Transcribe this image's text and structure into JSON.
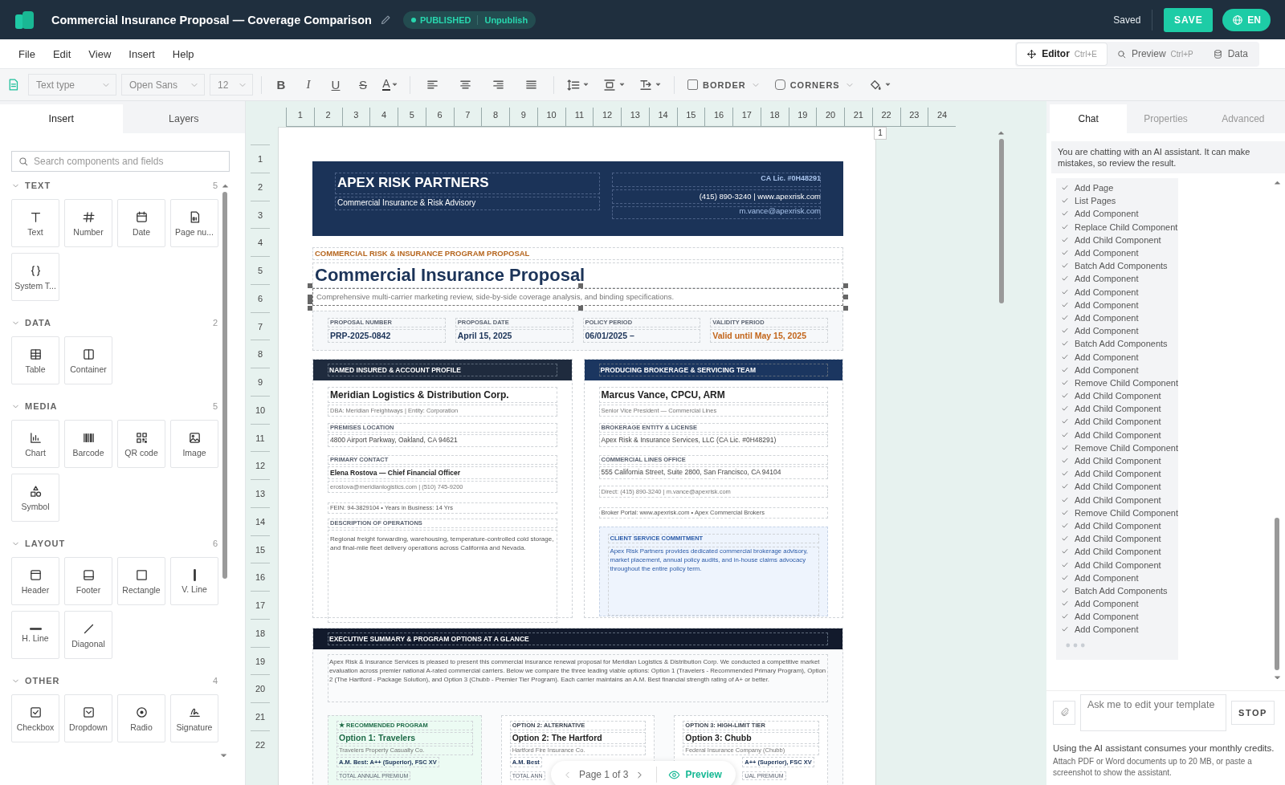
{
  "app_bar": {
    "title": "Commercial Insurance Proposal — Coverage Comparison",
    "status": "PUBLISHED",
    "unpublish": "Unpublish",
    "saved": "Saved",
    "save": "SAVE",
    "language": "EN"
  },
  "menu": [
    "File",
    "Edit",
    "View",
    "Insert",
    "Help"
  ],
  "modes": [
    {
      "label": "Editor",
      "shortcut": "Ctrl+E",
      "selected": true
    },
    {
      "label": "Preview",
      "shortcut": "Ctrl+P",
      "selected": false
    },
    {
      "label": "Data",
      "selected": false
    }
  ],
  "toolbar": {
    "text_type": "Text type",
    "font": "Open Sans",
    "size": "12",
    "styles": [
      "B",
      "I",
      "U",
      "S"
    ],
    "font_color": "A",
    "border": {
      "label": "BORDER",
      "checked": false
    },
    "corners": {
      "label": "CORNERS",
      "checked": false
    }
  },
  "left_panel": {
    "tabs": [
      {
        "label": "Insert",
        "selected": true
      },
      {
        "label": "Layers",
        "selected": false
      }
    ],
    "search": {
      "placeholder": "Search components and fields"
    },
    "sections": [
      {
        "title": "TEXT",
        "count": "5",
        "expanded": true,
        "items": [
          "Text",
          "Number",
          "Date",
          "Page nu...",
          "System T..."
        ]
      },
      {
        "title": "DATA",
        "count": "2",
        "expanded": true,
        "items": [
          "Table",
          "Container"
        ]
      },
      {
        "title": "MEDIA",
        "count": "5",
        "expanded": true,
        "items": [
          "Chart",
          "Barcode",
          "QR code",
          "Image",
          "Symbol"
        ]
      },
      {
        "title": "LAYOUT",
        "count": "6",
        "expanded": true,
        "items": [
          "Header",
          "Footer",
          "Rectangle",
          "V. Line",
          "H. Line",
          "Diagonal"
        ]
      },
      {
        "title": "OTHER",
        "count": "4",
        "expanded": true,
        "items": [
          "Checkbox",
          "Dropdown",
          "Radio",
          "Signature"
        ]
      }
    ]
  },
  "ruler": {
    "columns": [
      "1",
      "2",
      "3",
      "4",
      "5",
      "6",
      "7",
      "8",
      "9",
      "10",
      "11",
      "12",
      "13",
      "14",
      "15",
      "16",
      "17",
      "18",
      "19",
      "20",
      "21",
      "22",
      "23",
      "24"
    ],
    "rows": [
      "1",
      "2",
      "3",
      "4",
      "5",
      "6",
      "7",
      "8",
      "9",
      "10",
      "11",
      "12",
      "13",
      "14",
      "15",
      "16",
      "17",
      "18",
      "19",
      "20",
      "21",
      "22"
    ],
    "page_number": "1"
  },
  "document": {
    "header": {
      "company": "APEX RISK PARTNERS",
      "tagline": "Commercial Insurance & Risk Advisory",
      "license": "CA Lic. #0H48291",
      "contact": "(415) 890-3240  |  www.apexrisk.com",
      "email": "m.vance@apexrisk.com"
    },
    "eyebrow": "COMMERCIAL RISK & INSURANCE PROGRAM PROPOSAL",
    "title": "Commercial Insurance Proposal",
    "subtitle": {
      "text": "Comprehensive multi-carrier marketing review, side-by-side coverage analysis, and binding specifications.",
      "selected": true
    },
    "meta": [
      {
        "label": "PROPOSAL NUMBER",
        "value": "PRP-2025-0842",
        "kind": "normal"
      },
      {
        "label": "PROPOSAL DATE",
        "value": "April 15, 2025",
        "kind": "normal"
      },
      {
        "label": "POLICY PERIOD",
        "value": "06/01/2025 –",
        "kind": "normal"
      },
      {
        "label": "VALIDITY PERIOD",
        "value": "Valid until May 15, 2025",
        "kind": "alert"
      }
    ],
    "cards": [
      {
        "heading": "NAMED INSURED & ACCOUNT PROFILE",
        "color": "#1f2b3e",
        "blocks": [
          {
            "kind": "name",
            "text": "Meridian Logistics & Distribution Corp."
          },
          {
            "kind": "sub",
            "text": "DBA: Meridian Freightways  |  Entity: Corporation"
          },
          {
            "kind": "label",
            "text": "PREMISES LOCATION"
          },
          {
            "kind": "value",
            "text": "4800 Airport Parkway, Oakland, CA 94621"
          },
          {
            "kind": "label",
            "text": "PRIMARY CONTACT"
          },
          {
            "kind": "strong",
            "text": "Elena Rostova — Chief Financial Officer"
          },
          {
            "kind": "sub",
            "text": "erostova@meridianlogistics.com  |  (510) 745-9200"
          },
          {
            "kind": "line",
            "text": "FEIN: 94-3829104  •  Years in Business: 14 Yrs"
          },
          {
            "kind": "label",
            "text": "DESCRIPTION OF OPERATIONS"
          },
          {
            "kind": "para",
            "text": "Regional freight forwarding, warehousing, temperature-controlled cold storage, and final-mile fleet delivery operations across California and Nevada."
          }
        ]
      },
      {
        "heading": "PRODUCING BROKERAGE & SERVICING TEAM",
        "color": "#1b3660",
        "blocks": [
          {
            "kind": "name",
            "text": "Marcus Vance, CPCU, ARM"
          },
          {
            "kind": "sub",
            "text": "Senior Vice President — Commercial Lines"
          },
          {
            "kind": "label",
            "text": "BROKERAGE ENTITY & LICENSE"
          },
          {
            "kind": "value",
            "text": "Apex Risk & Insurance Services, LLC  (CA Lic. #0H48291)"
          },
          {
            "kind": "label",
            "text": "COMMERCIAL LINES OFFICE"
          },
          {
            "kind": "value",
            "text": "555 California Street, Suite 2800, San Francisco, CA 94104"
          },
          {
            "kind": "sub",
            "text": "Direct: (415) 890-3240  |  m.vance@apexrisk.com"
          },
          {
            "kind": "line",
            "text": "Broker Portal: www.apexrisk.com  •  Apex Commercial Brokers"
          },
          {
            "kind": "callout",
            "title": "CLIENT SERVICE COMMITMENT",
            "text": "Apex Risk Partners provides dedicated commercial brokerage advisory, market placement, annual policy audits, and in-house claims advocacy throughout the entire policy term."
          }
        ]
      }
    ],
    "summary": {
      "heading": "EXECUTIVE SUMMARY & PROGRAM OPTIONS AT A GLANCE",
      "text": "Apex Risk & Insurance Services is pleased to present this commercial insurance renewal proposal for Meridian Logistics & Distribution Corp. We conducted a competitive market evaluation across premier national A-rated commercial carriers. Below we compare the three leading viable options: Option 1 (Travelers - Recommended Primary Program), Option 2 (The Hartford - Package Solution), and Option 3 (Chubb - Premier Tier Program). Each carrier maintains an A.M. Best financial strength rating of A+ or better.",
      "options": [
        {
          "tag": "★ RECOMMENDED PROGRAM",
          "name": "Option 1: Travelers",
          "carrier": "Travelers Property Casualty Co.",
          "rating": "A.M. Best: A++ (Superior), FSC XV",
          "premium_label": "TOTAL ANNUAL PREMIUM",
          "recommended": true
        },
        {
          "tag": "OPTION 2: ALTERNATIVE",
          "name": "Option 2: The Hartford",
          "carrier": "Hartford Fire Insurance Co.",
          "rating": "A.M. Best",
          "premium_label": "TOTAL ANN",
          "recommended": false
        },
        {
          "tag": "OPTION 3: HIGH-LIMIT TIER",
          "name": "Option 3: Chubb",
          "carrier": "Federal Insurance Company (Chubb)",
          "rating": "A++ (Superior), FSC XV",
          "premium_label": "UAL PREMIUM",
          "recommended": false
        }
      ]
    }
  },
  "pager": {
    "text": "Page 1 of 3",
    "preview": "Preview"
  },
  "right_panel": {
    "tabs": [
      {
        "label": "Chat",
        "selected": true
      },
      {
        "label": "Properties",
        "selected": false
      },
      {
        "label": "Advanced",
        "selected": false
      }
    ],
    "notice": "You are chatting with an AI assistant. It can make mistakes, so review the result.",
    "steps": [
      {
        "text": "Add Page",
        "done": true
      },
      {
        "text": "List Pages",
        "done": true
      },
      {
        "text": "Add Component",
        "done": true
      },
      {
        "text": "Replace Child Component",
        "done": true
      },
      {
        "text": "Add Child Component",
        "done": true
      },
      {
        "text": "Add Component",
        "done": true
      },
      {
        "text": "Batch Add Components",
        "done": true
      },
      {
        "text": "Add Component",
        "done": true
      },
      {
        "text": "Add Component",
        "done": true
      },
      {
        "text": "Add Component",
        "done": true
      },
      {
        "text": "Add Component",
        "done": true
      },
      {
        "text": "Add Component",
        "done": true
      },
      {
        "text": "Batch Add Components",
        "done": true
      },
      {
        "text": "Add Component",
        "done": true
      },
      {
        "text": "Add Component",
        "done": true
      },
      {
        "text": "Remove Child Component",
        "done": true
      },
      {
        "text": "Add Child Component",
        "done": true
      },
      {
        "text": "Add Child Component",
        "done": true
      },
      {
        "text": "Add Child Component",
        "done": true
      },
      {
        "text": "Add Child Component",
        "done": true
      },
      {
        "text": "Remove Child Component",
        "done": true
      },
      {
        "text": "Add Child Component",
        "done": true
      },
      {
        "text": "Add Child Component",
        "done": true
      },
      {
        "text": "Add Child Component",
        "done": true
      },
      {
        "text": "Add Child Component",
        "done": true
      },
      {
        "text": "Remove Child Component",
        "done": true
      },
      {
        "text": "Add Child Component",
        "done": true
      },
      {
        "text": "Add Child Component",
        "done": true
      },
      {
        "text": "Add Child Component",
        "done": true
      },
      {
        "text": "Add Child Component",
        "done": true
      },
      {
        "text": "Add Component",
        "done": true
      },
      {
        "text": "Batch Add Components",
        "done": true
      },
      {
        "text": "Add Component",
        "done": true
      },
      {
        "text": "Add Component",
        "done": true
      },
      {
        "text": "Add Component",
        "done": true
      }
    ],
    "composer": {
      "placeholder": "Ask me to edit your template",
      "stop": "STOP"
    },
    "credits_note": "Using the AI assistant consumes your monthly credits.",
    "attach_note": "Attach PDF or Word documents up to 20 MB, or paste a screenshot to show the assistant."
  }
}
